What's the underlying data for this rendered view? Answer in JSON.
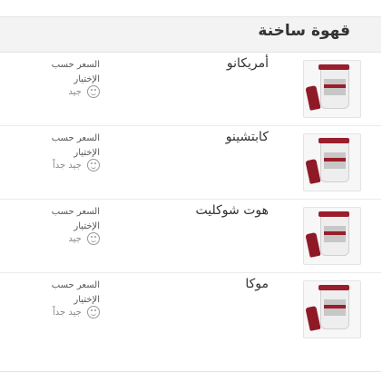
{
  "section": {
    "title": "قهوة ساخنة"
  },
  "items": [
    {
      "name": "أمريكانو",
      "price_label": "السعر حسب الإختيار",
      "rating": "جيد",
      "image": "coffee-cup-image"
    },
    {
      "name": "كابتشينو",
      "price_label": "السعر حسب الإختيار",
      "rating": "جيد جداً",
      "image": "coffee-cup-image"
    },
    {
      "name": "هوت شوكليت",
      "price_label": "السعر حسب الإختيار",
      "rating": "جيد",
      "image": "coffee-cup-image"
    },
    {
      "name": "موكا",
      "price_label": "السعر حسب الإختيار",
      "rating": "جيد جداً",
      "image": "coffee-cup-image"
    }
  ]
}
